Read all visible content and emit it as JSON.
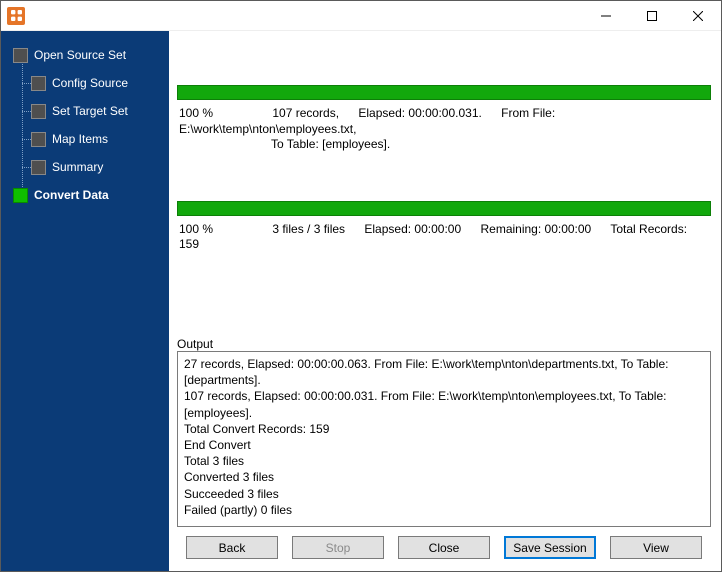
{
  "sidebar": {
    "items": [
      {
        "label": "Open Source Set",
        "child": false,
        "current": false
      },
      {
        "label": "Config Source",
        "child": true,
        "current": false
      },
      {
        "label": "Set Target Set",
        "child": true,
        "current": false
      },
      {
        "label": "Map Items",
        "child": true,
        "current": false
      },
      {
        "label": "Summary",
        "child": true,
        "current": false
      },
      {
        "label": "Convert Data",
        "child": false,
        "current": true
      }
    ]
  },
  "progress": {
    "file": {
      "percent": "100 %",
      "records": "107 records,",
      "elapsed": "Elapsed: 00:00:00.031.",
      "from": "From File: E:\\work\\temp\\nton\\employees.txt,",
      "to": "To Table: [employees]."
    },
    "overall": {
      "percent": "100 %",
      "files": "3 files / 3 files",
      "elapsed": "Elapsed: 00:00:00",
      "remaining": "Remaining: 00:00:00",
      "total": "Total Records: 159"
    }
  },
  "output": {
    "label": "Output",
    "lines": [
      "27 records,    Elapsed: 00:00:00.063.    From File: E:\\work\\temp\\nton\\departments.txt,    To Table: [departments].",
      "107 records,    Elapsed: 00:00:00.031.    From File: E:\\work\\temp\\nton\\employees.txt,    To Table: [employees].",
      "Total Convert Records: 159",
      "End Convert",
      "Total 3 files",
      "Converted 3 files",
      "Succeeded 3 files",
      "Failed (partly) 0 files"
    ]
  },
  "buttons": {
    "back": "Back",
    "stop": "Stop",
    "close": "Close",
    "save": "Save Session",
    "view": "View"
  }
}
